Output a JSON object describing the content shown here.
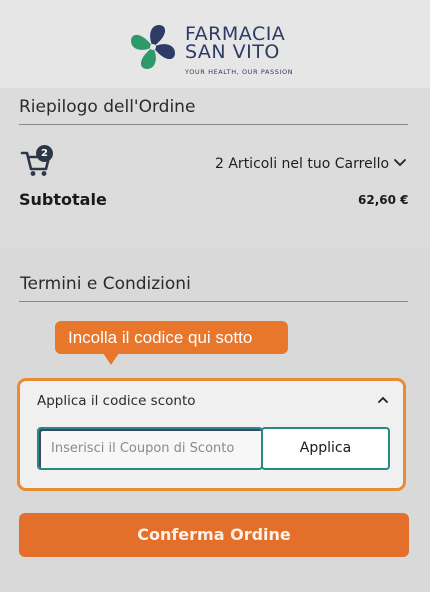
{
  "brand": {
    "line1": "FARMACIA",
    "line2": "SAN VITO",
    "tagline": "YOUR HEALTH, OUR PASSION",
    "colors": {
      "navy": "#2e3b64",
      "green": "#2e9a6a"
    }
  },
  "summary": {
    "title": "Riepilogo dell'Ordine",
    "cart_badge": "2",
    "cart_count_label": "2 Articoli nel tuo Carrello",
    "subtotal_label": "Subtotale",
    "subtotal_value": "62,60 €",
    "icons": {
      "cart": "cart-icon",
      "expand": "chevron-down-icon"
    }
  },
  "terms": {
    "title": "Termini e Condizioni"
  },
  "tooltip": {
    "text": "Incolla il codice qui sotto",
    "color": "#e8762b"
  },
  "coupon": {
    "title": "Applica il codice sconto",
    "input_placeholder": "Inserisci il Coupon di Sconto",
    "input_value": "",
    "apply_label": "Applica",
    "highlight_color": "#ea8a33",
    "icons": {
      "collapse": "chevron-up-icon"
    }
  },
  "confirm": {
    "label": "Conferma Ordine",
    "color": "#e36f2a"
  }
}
